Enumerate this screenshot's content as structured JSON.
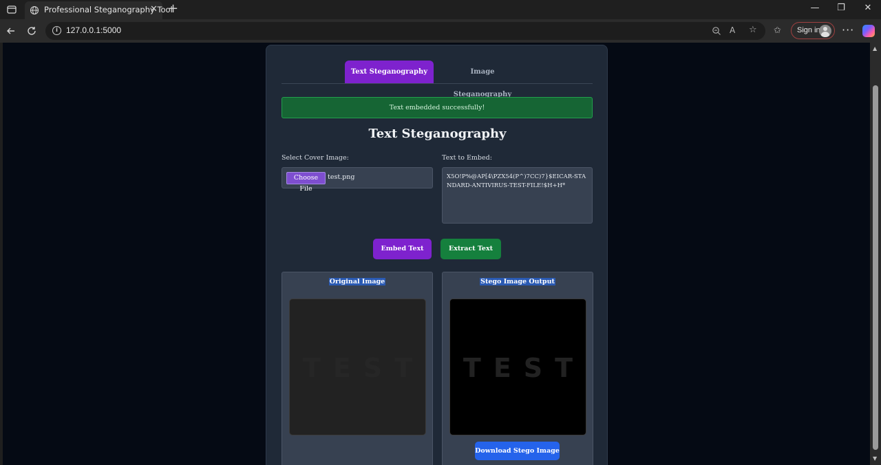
{
  "browser": {
    "tab_title": "Professional Steganography Tool",
    "url": "127.0.0.1:5000",
    "sign_in_label": "Sign in"
  },
  "app": {
    "tabs": [
      {
        "label": "Text Steganography",
        "active": true
      },
      {
        "label": "Image Steganography",
        "active": false
      }
    ],
    "alert": "Text embedded successfully!",
    "heading": "Text Steganography",
    "cover_label": "Select Cover Image:",
    "choose_file_label": "Choose File",
    "file_name": "test.png",
    "text_label": "Text to Embed:",
    "text_value": "X5O!P%@AP[4\\PZX54(P^)7CC)7}$EICAR-STANDARD-ANTIVIRUS-TEST-FILE!$H+H*",
    "embed_button": "Embed Text",
    "extract_button": "Extract Text",
    "original_title": "Original Image",
    "stego_title": "Stego Image Output",
    "image_text": "TEST",
    "download_button": "Download Stego Image"
  },
  "colors": {
    "accent_purple": "#7e22ce",
    "success_green": "#15803d",
    "download_blue": "#2563eb",
    "page_bg": "#050a14",
    "card_bg": "#1f2937"
  }
}
